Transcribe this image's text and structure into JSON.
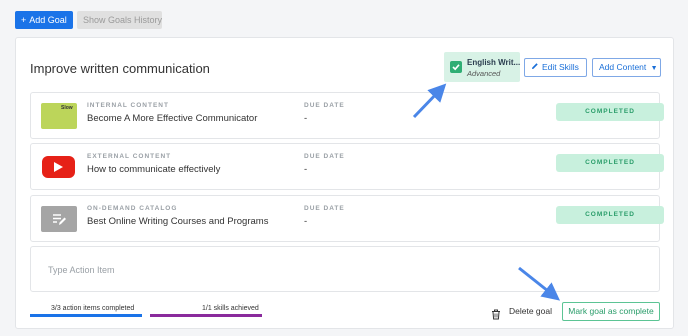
{
  "toolbar": {
    "add_goal": "Add Goal",
    "show_history": "Show Goals History"
  },
  "goal": {
    "title": "Improve written communication",
    "skill": {
      "name": "English Writ...",
      "level": "Advanced"
    },
    "edit_skills": "Edit Skills",
    "add_content": "Add Content",
    "items": [
      {
        "type": "INTERNAL CONTENT",
        "name": "Become A More Effective Communicator",
        "due_label": "DUE DATE",
        "due": "-",
        "status": "COMPLETED",
        "thumb_text": "Slow"
      },
      {
        "type": "EXTERNAL CONTENT",
        "name": "How to communicate effectively",
        "due_label": "DUE DATE",
        "due": "-",
        "status": "COMPLETED"
      },
      {
        "type": "ON-DEMAND CATALOG",
        "name": "Best Online Writing Courses and Programs",
        "due_label": "DUE DATE",
        "due": "-",
        "status": "COMPLETED"
      }
    ],
    "action_placeholder": "Type Action Item",
    "progress": {
      "actions_label": "3/3 action items completed",
      "actions_fraction": 1.0,
      "skills_label": "1/1 skills achieved",
      "skills_fraction": 1.0
    },
    "delete_goal": "Delete goal",
    "mark_complete": "Mark goal as complete"
  },
  "colors": {
    "primary": "#1a73e8",
    "success": "#2a9d6a",
    "success_bg": "#c8f0dd",
    "skills_bar": "#8a2a9c",
    "annotation_arrow": "#4a86e8"
  }
}
